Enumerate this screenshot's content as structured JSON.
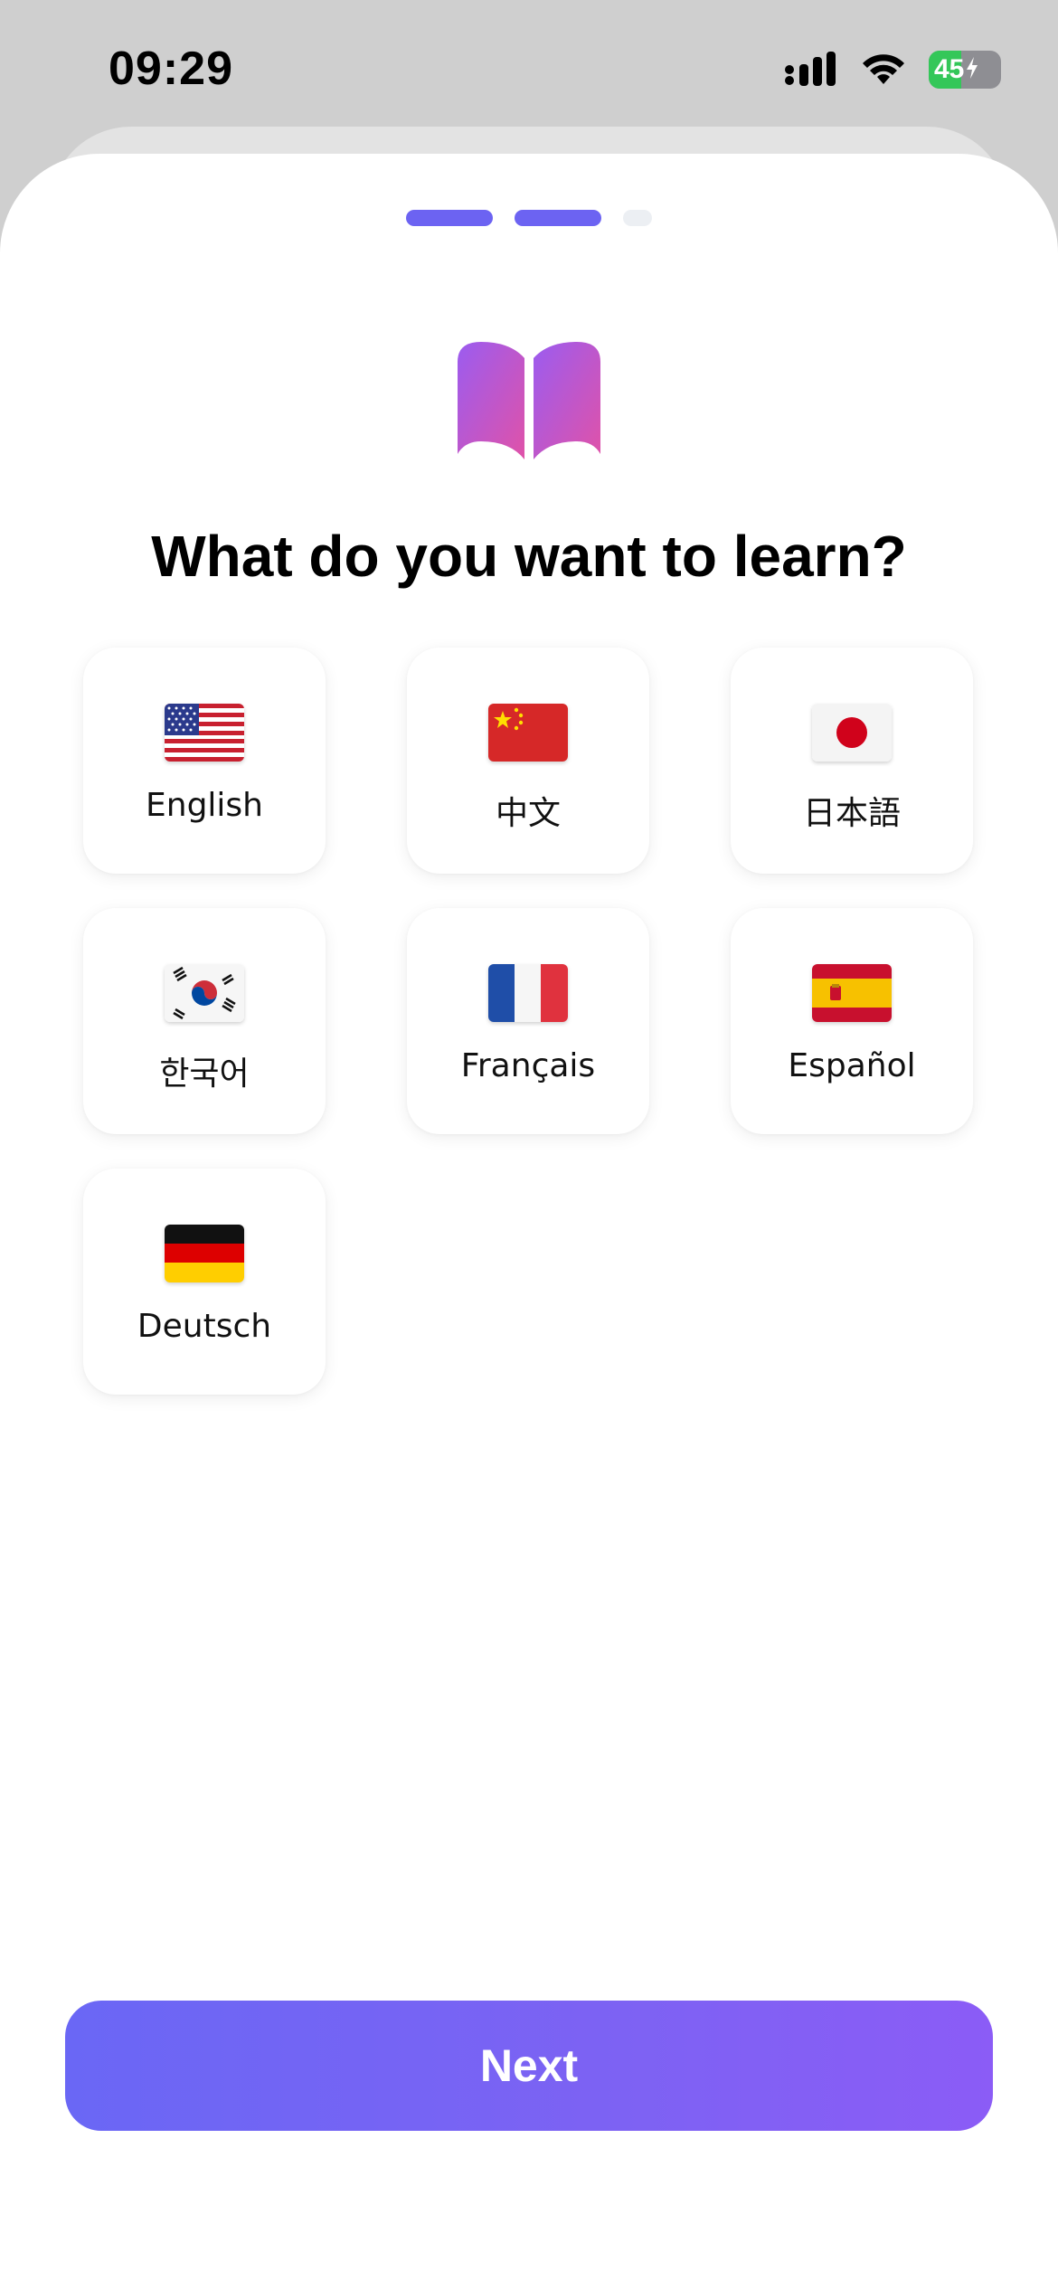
{
  "status_bar": {
    "time": "09:29",
    "battery": "45",
    "battery_level": 0.45,
    "icons": [
      "cellular-signal-icon",
      "wifi-icon",
      "battery-charging-icon"
    ]
  },
  "progress": {
    "total_steps": 3,
    "current_step": 2
  },
  "header": {
    "icon": "open-book-icon",
    "title": "What do you want to learn?"
  },
  "languages": [
    {
      "label": "English",
      "flag": "us-flag"
    },
    {
      "label": "中文",
      "flag": "china-flag"
    },
    {
      "label": "日本語",
      "flag": "japan-flag"
    },
    {
      "label": "한국어",
      "flag": "korea-flag"
    },
    {
      "label": "Français",
      "flag": "france-flag"
    },
    {
      "label": "Español",
      "flag": "spain-flag"
    },
    {
      "label": "Deutsch",
      "flag": "germany-flag"
    }
  ],
  "footer": {
    "next_label": "Next"
  },
  "colors": {
    "accent": "#6c63f2",
    "button_gradient_start": "#6a67f5",
    "button_gradient_end": "#8b5cf6",
    "book_gradient_start": "#9b5cf0",
    "book_gradient_end": "#e052a8",
    "battery_green": "#34c759"
  }
}
